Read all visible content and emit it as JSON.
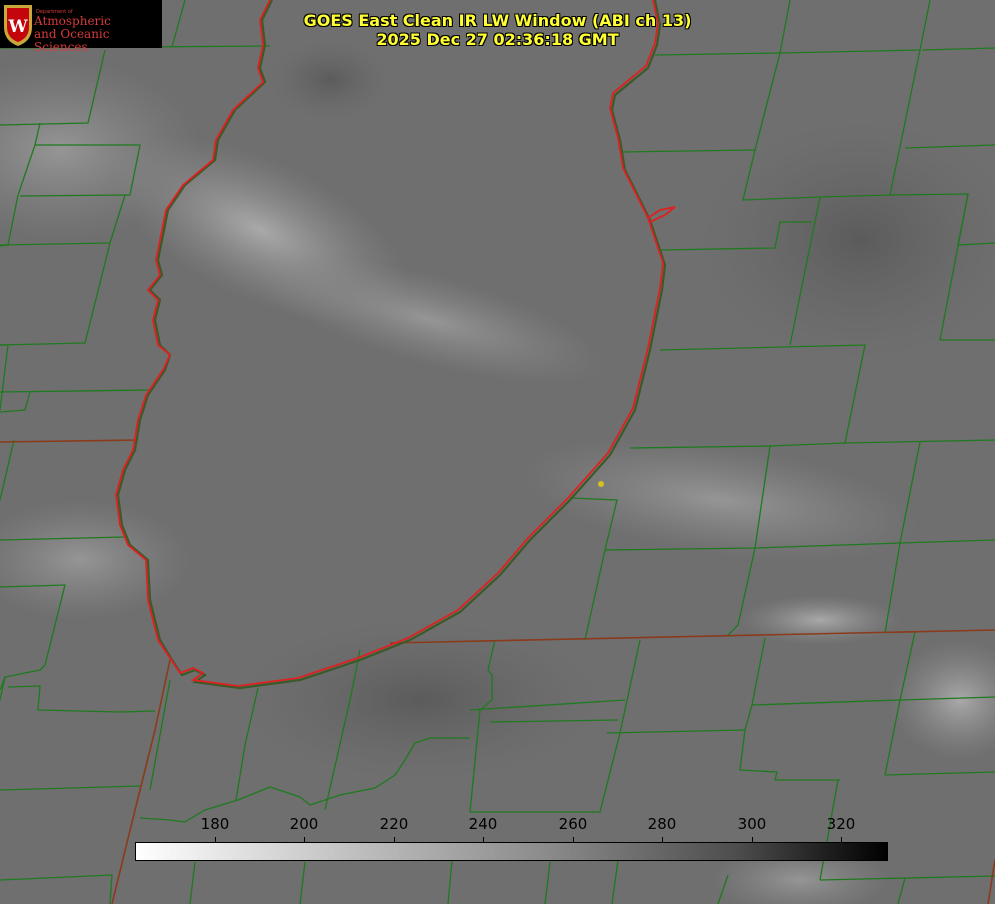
{
  "title": {
    "line1": "GOES East Clean IR LW Window (ABI ch 13)",
    "line2": "2025 Dec 27 02:36:18 GMT"
  },
  "logo": {
    "dept": "Department of",
    "line1": "Atmospheric",
    "line2": "and Oceanic Sciences",
    "emblem": "W"
  },
  "colorbar": {
    "ticks": [
      "180",
      "200",
      "220",
      "240",
      "260",
      "280",
      "300",
      "320"
    ]
  },
  "colors": {
    "county_lines": "#1e7a1e",
    "lake_outline": "#e02020",
    "state_lines": "#8b3a1a",
    "title_text": "#ffff33",
    "site_marker": "#d4c020"
  }
}
